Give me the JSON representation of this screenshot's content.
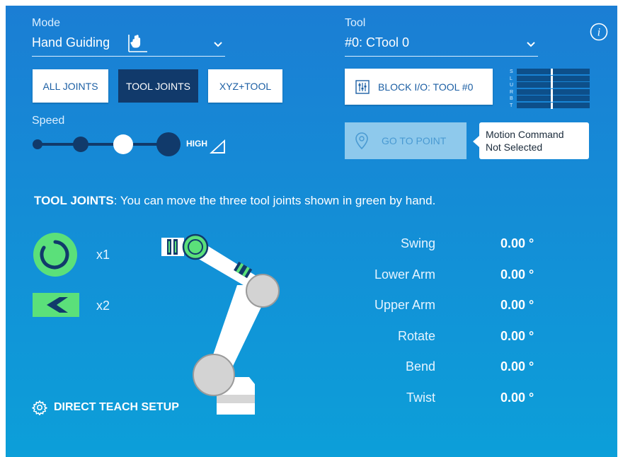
{
  "mode": {
    "label": "Mode",
    "value": "Hand Guiding"
  },
  "tool": {
    "label": "Tool",
    "value": "#0: CTool 0"
  },
  "info_icon": "info-icon",
  "jog_buttons": [
    {
      "label": "ALL JOINTS",
      "selected": false
    },
    {
      "label": "TOOL JOINTS",
      "selected": true
    },
    {
      "label": "XYZ+TOOL",
      "selected": false
    }
  ],
  "speed": {
    "label": "Speed",
    "level_label": "HIGH",
    "steps": 4,
    "selected_step": 3
  },
  "block_io": {
    "label": "BLOCK I/O: TOOL #0"
  },
  "axis_meter": {
    "letters": [
      "S",
      "L",
      "U",
      "R",
      "B",
      "T"
    ]
  },
  "go_to_point": {
    "label": "GO TO POINT",
    "enabled": false
  },
  "tooltip": {
    "line1": "Motion Command",
    "line2": "Not Selected"
  },
  "description": {
    "bold": "TOOL JOINTS",
    "rest": ": You can move the three tool joints shown in green by hand."
  },
  "legend": {
    "rotate_count": "x1",
    "bend_count": "x2"
  },
  "joints": [
    {
      "name": "Swing",
      "value": "0.00 °"
    },
    {
      "name": "Lower Arm",
      "value": "0.00 °"
    },
    {
      "name": "Upper Arm",
      "value": "0.00 °"
    },
    {
      "name": "Rotate",
      "value": "0.00 °"
    },
    {
      "name": "Bend",
      "value": "0.00 °"
    },
    {
      "name": "Twist",
      "value": "0.00 °"
    }
  ],
  "setup": {
    "label": "DIRECT TEACH SETUP"
  },
  "colors": {
    "accent_green": "#5be07a",
    "dark_navy": "#113a6b",
    "panel_top": "#1b7ed4",
    "panel_bottom": "#0c9fd9"
  }
}
